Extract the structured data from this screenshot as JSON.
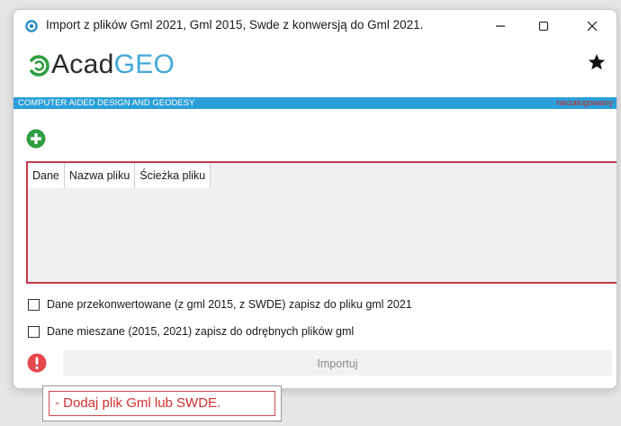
{
  "window": {
    "title": "Import z plików Gml 2021, Gml 2015, Swde z konwersją do Gml 2021.",
    "controls": {
      "minimize_icon": "minimize-icon",
      "maximize_icon": "maximize-icon",
      "close_icon": "close-icon"
    }
  },
  "logo": {
    "part1": "Acad",
    "part2": "GEO"
  },
  "banner": {
    "tagline": "COMPUTER AIDED DESIGN AND GEODESY",
    "login_status": "niezalogowany"
  },
  "grid": {
    "columns": [
      "Dane",
      "Nazwa pliku",
      "Ścieżka pliku"
    ],
    "rows": []
  },
  "options": {
    "convert_label": "Dane przekonwertowane (z gml 2015, z SWDE) zapisz do pliku gml 2021",
    "convert_checked": false,
    "mixed_label": "Dane mieszane (2015, 2021) zapisz do odrębnych plików gml",
    "mixed_checked": false
  },
  "actions": {
    "import_label": "Importuj"
  },
  "tooltip": {
    "message": "- Dodaj plik Gml lub SWDE."
  },
  "icons": {
    "add": "add-circle-icon",
    "warning": "exclamation-circle-icon",
    "favorite": "star-icon"
  },
  "colors": {
    "accent": "#2a9fd8",
    "logo_geo": "#41a8d8",
    "error": "#c23a4a",
    "add_green": "#2e9e3f",
    "warning_red": "#e5484d"
  }
}
